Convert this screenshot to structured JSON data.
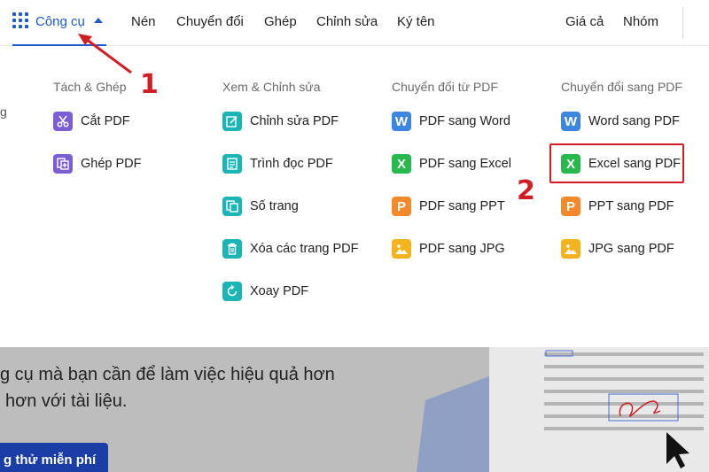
{
  "nav": {
    "tools_label": "Công cụ",
    "items": [
      "Nén",
      "Chuyển đổi",
      "Ghép",
      "Chỉnh sửa",
      "Ký tên"
    ],
    "pricing": "Giá cả",
    "teams": "Nhóm"
  },
  "menu": {
    "left_edge_text": "g",
    "columns": [
      {
        "heading": "Tách & Ghép",
        "items": [
          {
            "label": "Cắt PDF",
            "icon": "scissors-icon",
            "color": "#7b5ed6"
          },
          {
            "label": "Ghép PDF",
            "icon": "merge-icon",
            "color": "#7b5ed6"
          }
        ]
      },
      {
        "heading": "Xem & Chỉnh sửa",
        "items": [
          {
            "label": "Chỉnh sửa PDF",
            "icon": "edit-icon",
            "color": "#1cb5b5"
          },
          {
            "label": "Trình đọc PDF",
            "icon": "reader-icon",
            "color": "#1cb5b5"
          },
          {
            "label": "Số trang",
            "icon": "page-number-icon",
            "color": "#1cb5b5"
          },
          {
            "label": "Xóa các trang PDF",
            "icon": "trash-icon",
            "color": "#1cb5b5"
          },
          {
            "label": "Xoay PDF",
            "icon": "rotate-icon",
            "color": "#1cb5b5"
          }
        ]
      },
      {
        "heading": "Chuyển đổi từ PDF",
        "items": [
          {
            "label": "PDF sang Word",
            "icon": "word-icon",
            "color": "#3d86e0"
          },
          {
            "label": "PDF sang Excel",
            "icon": "excel-icon",
            "color": "#27b84e"
          },
          {
            "label": "PDF sang PPT",
            "icon": "ppt-icon",
            "color": "#f28a2c"
          },
          {
            "label": "PDF sang JPG",
            "icon": "jpg-icon",
            "color": "#f2b31c"
          }
        ]
      },
      {
        "heading": "Chuyển đổi sang PDF",
        "items": [
          {
            "label": "Word sang PDF",
            "icon": "word-icon",
            "color": "#3d86e0"
          },
          {
            "label": "Excel sang PDF",
            "icon": "excel-icon",
            "color": "#27b84e"
          },
          {
            "label": "PPT sang PDF",
            "icon": "ppt-icon",
            "color": "#f28a2c"
          },
          {
            "label": "JPG sang PDF",
            "icon": "jpg-icon",
            "color": "#f2b31c"
          }
        ]
      }
    ]
  },
  "annotations": {
    "step1": "1",
    "step2": "2",
    "color": "#d11e26"
  },
  "background_page": {
    "line1": "g cụ mà bạn cần để làm việc hiệu quả hơn",
    "line2": "hơn với tài liệu.",
    "cta": "g thử miễn phí"
  }
}
